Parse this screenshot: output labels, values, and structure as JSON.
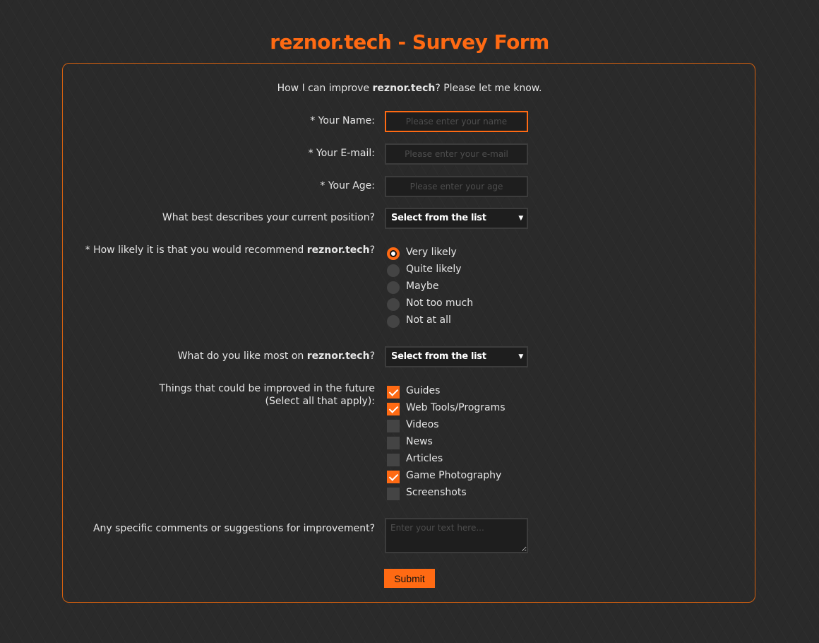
{
  "page": {
    "title": "reznor.tech - Survey Form"
  },
  "intro": {
    "prefix": "How I can improve ",
    "site": "reznor.tech",
    "suffix": "? Please let me know."
  },
  "name_field": {
    "label": "* Your Name:",
    "placeholder": "Please enter your name",
    "value": ""
  },
  "email_field": {
    "label": "* Your E-mail:",
    "placeholder": "Please enter your e-mail",
    "value": ""
  },
  "age_field": {
    "label": "* Your Age:",
    "placeholder": "Please enter your age",
    "value": ""
  },
  "position_field": {
    "label": "What best describes your current position?",
    "selected": "Select from the list"
  },
  "recommend_field": {
    "label_prefix": "* How likely it is that you would recommend ",
    "label_site": "reznor.tech",
    "label_suffix": "?",
    "options": [
      {
        "label": "Very likely",
        "selected": true
      },
      {
        "label": "Quite likely",
        "selected": false
      },
      {
        "label": "Maybe",
        "selected": false
      },
      {
        "label": "Not too much",
        "selected": false
      },
      {
        "label": "Not at all",
        "selected": false
      }
    ]
  },
  "like_field": {
    "label_prefix": "What do you like most on ",
    "label_site": "reznor.tech",
    "label_suffix": "?",
    "selected": "Select from the list"
  },
  "improve_field": {
    "label_line1": "Things that could be improved in the future",
    "label_line2": "(Select all that apply):",
    "options": [
      {
        "label": "Guides",
        "checked": true
      },
      {
        "label": "Web Tools/Programs",
        "checked": true
      },
      {
        "label": "Videos",
        "checked": false
      },
      {
        "label": "News",
        "checked": false
      },
      {
        "label": "Articles",
        "checked": false
      },
      {
        "label": "Game Photography",
        "checked": true
      },
      {
        "label": "Screenshots",
        "checked": false
      }
    ]
  },
  "comments_field": {
    "label": "Any specific comments or suggestions for improvement?",
    "placeholder": "Enter your text here...",
    "value": ""
  },
  "submit": {
    "label": "Submit"
  },
  "colors": {
    "accent": "#ff6a13",
    "background": "#2a2a2a",
    "field_background": "#1e1e1e"
  },
  "icons": {
    "select_arrow": "▼"
  }
}
